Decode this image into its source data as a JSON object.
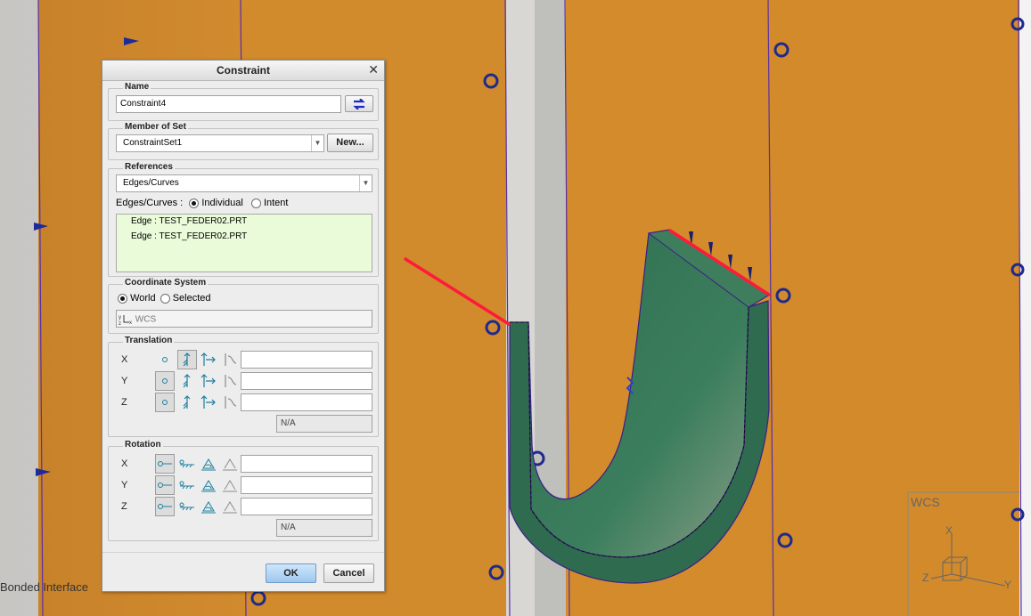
{
  "dialog": {
    "title": "Constraint",
    "name": {
      "label": "Name",
      "value": "Constraint4"
    },
    "member_of_set": {
      "label": "Member of Set",
      "value": "ConstraintSet1",
      "new_button": "New..."
    },
    "references": {
      "label": "References",
      "type": "Edges/Curves",
      "mode_label": "Edges/Curves :",
      "individual": "Individual",
      "intent": "Intent",
      "items": [
        "Edge : TEST_FEDER02.PRT",
        "Edge : TEST_FEDER02.PRT"
      ]
    },
    "coordinate_system": {
      "label": "Coordinate System",
      "world": "World",
      "selected": "Selected",
      "value": "WCS"
    },
    "translation": {
      "label": "Translation",
      "axes": [
        "X",
        "Y",
        "Z"
      ],
      "na": "N/A"
    },
    "rotation": {
      "label": "Rotation",
      "axes": [
        "X",
        "Y",
        "Z"
      ],
      "na": "N/A"
    },
    "ok": "OK",
    "cancel": "Cancel"
  },
  "viewport": {
    "wcs_label": "WCS",
    "triad_x": "X",
    "triad_y": "Y",
    "triad_z": "Z"
  },
  "status": {
    "text": "Bonded Interface"
  },
  "colors": {
    "panel": "#d48a2c",
    "part": "#3a7a5a",
    "edge_highlight": "#ff1a3a",
    "accent_blue": "#1a2bb8"
  }
}
